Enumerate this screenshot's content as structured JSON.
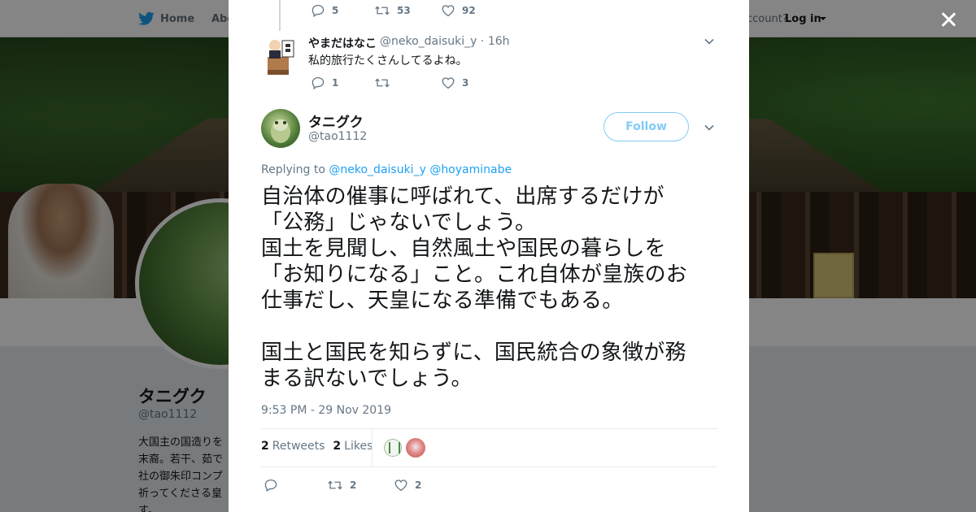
{
  "background": {
    "topbar": {
      "home_label": "Home",
      "about_label": "Abo",
      "have_account_label": "ccount?",
      "login_label": "Log in"
    },
    "profile": {
      "name": "タニグク",
      "handle": "@tao1112",
      "bio_lines": [
        "大国主の国造りを",
        "末裔。若干、茹で",
        "社の御朱印コンプ",
        "祈ってくださる皇",
        "す。"
      ]
    }
  },
  "modal": {
    "reply_tweet": {
      "prev_actions": {
        "replies": "5",
        "retweets": "53",
        "likes": "92"
      },
      "name": "やまだはなこ",
      "handle": "@neko_daisuki_y",
      "separator": "·",
      "time": "16h",
      "text": "私的旅行たくさんしてるよね。",
      "actions": {
        "replies": "1",
        "retweets": "",
        "likes": "3"
      }
    },
    "main_tweet": {
      "name": "タニグク",
      "handle": "@tao1112",
      "follow_label": "Follow",
      "replying_to_label": "Replying to",
      "mentions": [
        "@neko_daisuki_y",
        "@hoyaminabe"
      ],
      "text_lines": [
        "自治体の催事に呼ばれて、出席するだけが",
        "「公務」じゃないでしょう。",
        "国土を見聞し、自然風土や国民の暮らしを",
        "「お知りになる」こと。これ自体が皇族のお",
        "仕事だし、天皇になる準備でもある。",
        "",
        "国土と国民を知らずに、国民統合の象徴が務",
        "まる訳ないでしょう。"
      ],
      "timestamp": "9:53 PM - 29 Nov 2019",
      "stats": {
        "retweets_count": "2",
        "retweets_label": "Retweets",
        "likes_count": "2",
        "likes_label": "Likes"
      },
      "actions": {
        "replies": "",
        "retweets": "2",
        "likes": "2"
      }
    }
  },
  "colors": {
    "accent": "#1da1f2",
    "text_primary": "#14171a",
    "text_secondary": "#657786"
  },
  "icons": [
    "twitter-bird-icon",
    "close-icon",
    "reply-icon",
    "retweet-icon",
    "like-icon",
    "chevron-down-icon"
  ]
}
